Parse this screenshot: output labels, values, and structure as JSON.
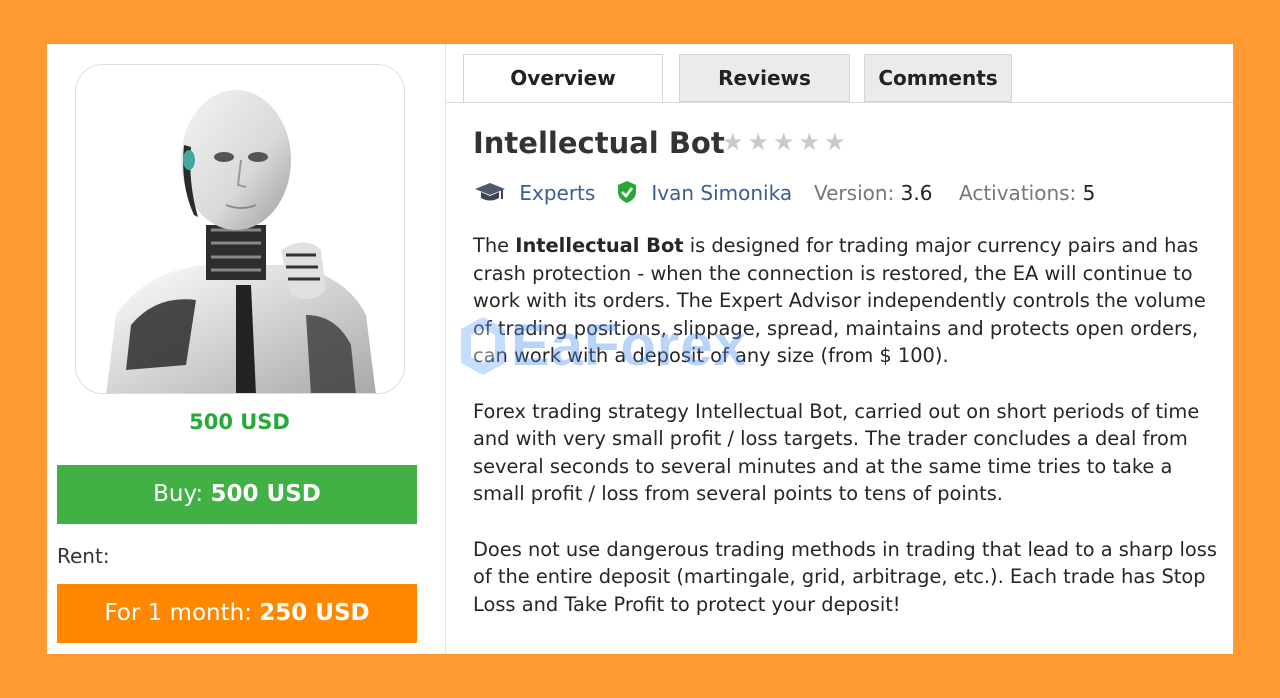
{
  "product": {
    "price_text": "500 USD",
    "buy_label": "Buy:",
    "buy_price": "500 USD",
    "rent_label": "Rent:",
    "rent_period": "For 1 month:",
    "rent_price": "250 USD",
    "avatar_icon": "robot-avatar"
  },
  "tabs": [
    {
      "label": "Overview",
      "active": true
    },
    {
      "label": "Reviews",
      "active": false
    },
    {
      "label": "Comments",
      "active": false
    }
  ],
  "header": {
    "title": "Intellectual Bot",
    "rating_stars": 0,
    "rating_max": 5
  },
  "meta": {
    "category_icon": "graduation-cap-icon",
    "category": "Experts",
    "author_icon": "verified-check-icon",
    "author": "Ivan Simonika",
    "version_label": "Version:",
    "version_value": "3.6",
    "activations_label": "Activations:",
    "activations_value": "5"
  },
  "description": {
    "p1_prefix": "The ",
    "p1_bold": "Intellectual Bot",
    "p1_rest": " is designed for trading major currency pairs and has crash protection - when the connection is restored, the EA will continue to work with its orders. The Expert Advisor independently controls the volume of trading positions, slippage, spread, maintains and protects open orders, can work with a deposit of any size (from $ 100).",
    "p2": "Forex trading strategy Intellectual Bot, carried out on short periods of time and with very small profit / loss targets. The trader concludes a deal from several seconds to several minutes and at the same time tries to take a small profit / loss from several points to tens of points.",
    "p3": "Does not use dangerous trading methods in trading that lead to a sharp loss of the entire deposit (martingale, grid, arbitrage, etc.). Each trade has Stop Loss and Take Profit to protect your deposit!"
  },
  "watermark": {
    "text": "EaForex"
  },
  "colors": {
    "background": "#ff9a33",
    "buy": "#41b144",
    "rent": "#ff8800",
    "price": "#27a837",
    "link": "#3a5d96"
  }
}
